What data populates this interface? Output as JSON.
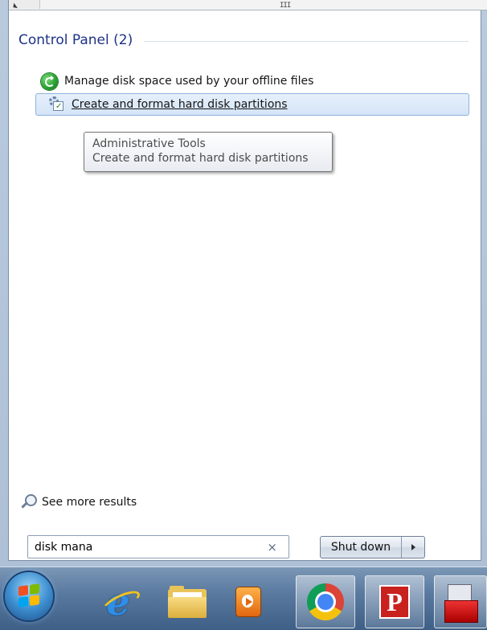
{
  "top_strip": {
    "grip_text": "III"
  },
  "results_group": {
    "title": "Control Panel (2)",
    "items": [
      {
        "label": "Manage disk space used by your offline files",
        "icon": "sync-icon"
      },
      {
        "label": "Create and format hard disk partitions",
        "icon": "disk-partition-icon",
        "state": "hover"
      }
    ]
  },
  "tooltip": {
    "line1": "Administrative Tools",
    "line2": "Create and format hard disk partitions"
  },
  "see_more": {
    "label": "See more results",
    "icon": "search-lens-icon"
  },
  "search": {
    "value": "disk mana",
    "clear_glyph": "×"
  },
  "shutdown": {
    "label": "Shut down"
  },
  "taskbar": {
    "items": [
      "start-orb-icon",
      "internet-explorer-icon",
      "windows-explorer-icon",
      "media-player-icon",
      "chrome-icon",
      "powerpoint-icon",
      "toolbox-icon"
    ],
    "powerpoint_glyph": "P"
  },
  "colors": {
    "group_title": "#1e3287",
    "highlight_border": "#8fb3dc",
    "highlight_fill": "#d4e4f7",
    "taskbar": "#5a7aa0"
  }
}
